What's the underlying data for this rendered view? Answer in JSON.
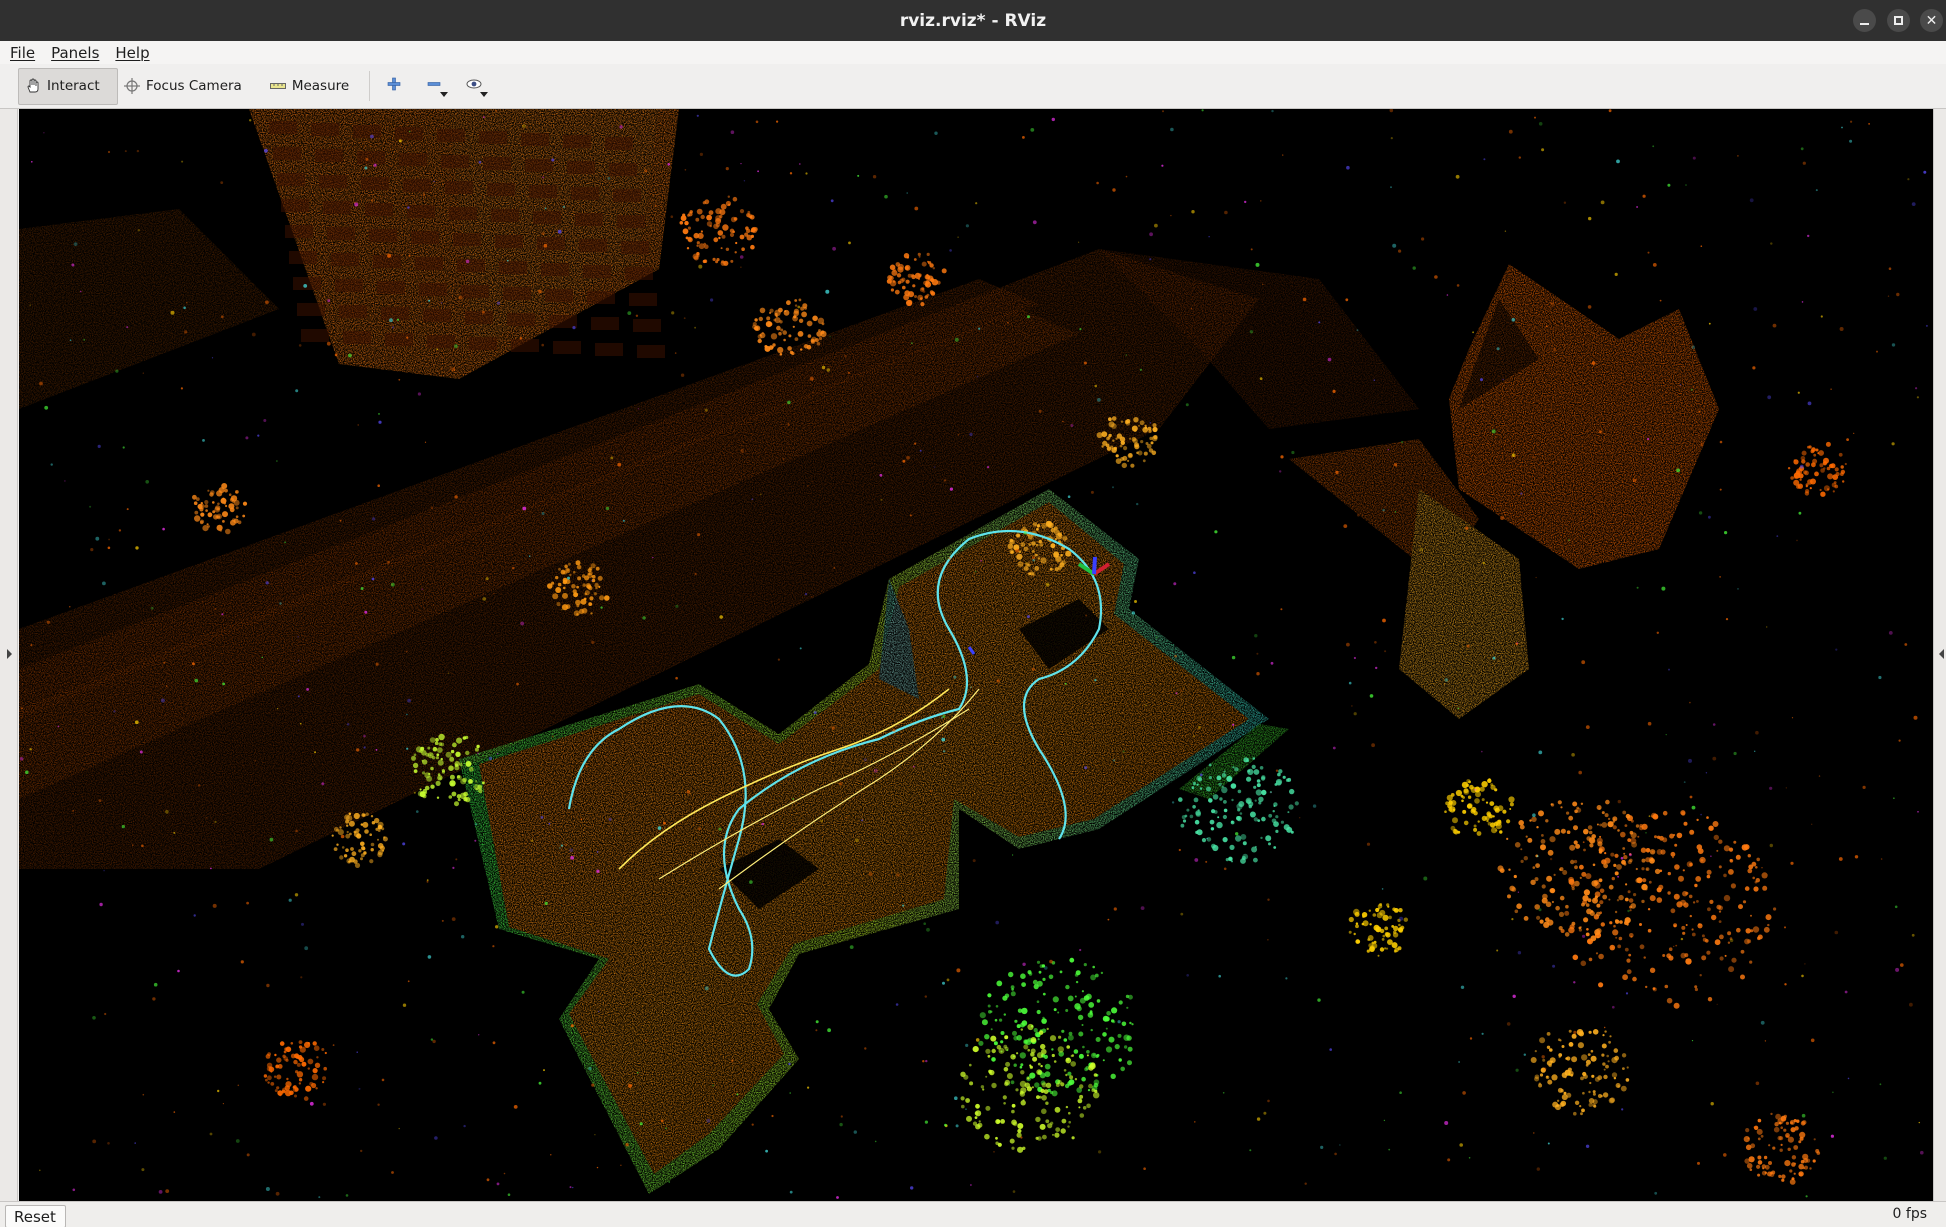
{
  "window": {
    "title": "rviz.rviz* - RViz",
    "controls": {
      "minimize": "minimize-icon",
      "maximize": "maximize-icon",
      "close": "close-icon"
    }
  },
  "menubar": {
    "items": [
      {
        "label": "File"
      },
      {
        "label": "Panels"
      },
      {
        "label": "Help"
      }
    ]
  },
  "toolbar": {
    "tools": [
      {
        "label": "Interact",
        "icon": "hand-icon",
        "active": true
      },
      {
        "label": "Focus Camera",
        "icon": "crosshair-icon",
        "active": false
      },
      {
        "label": "Measure",
        "icon": "ruler-icon",
        "active": false
      }
    ],
    "extra_buttons": [
      {
        "icon": "add-tool-icon"
      },
      {
        "icon": "remove-tool-icon"
      },
      {
        "icon": "view-eye-icon"
      }
    ]
  },
  "viewport": {
    "content": "3d-pointcloud-render",
    "background": "#000000",
    "colors": {
      "orange": "#ff6a00",
      "yellow": "#ffd000",
      "green": "#49ff3a",
      "cyan": "#44e6e6",
      "magenta": "#ff33ff",
      "blue": "#5a4cff"
    }
  },
  "statusbar": {
    "reset_label": "Reset",
    "fps_label": "0 fps"
  }
}
